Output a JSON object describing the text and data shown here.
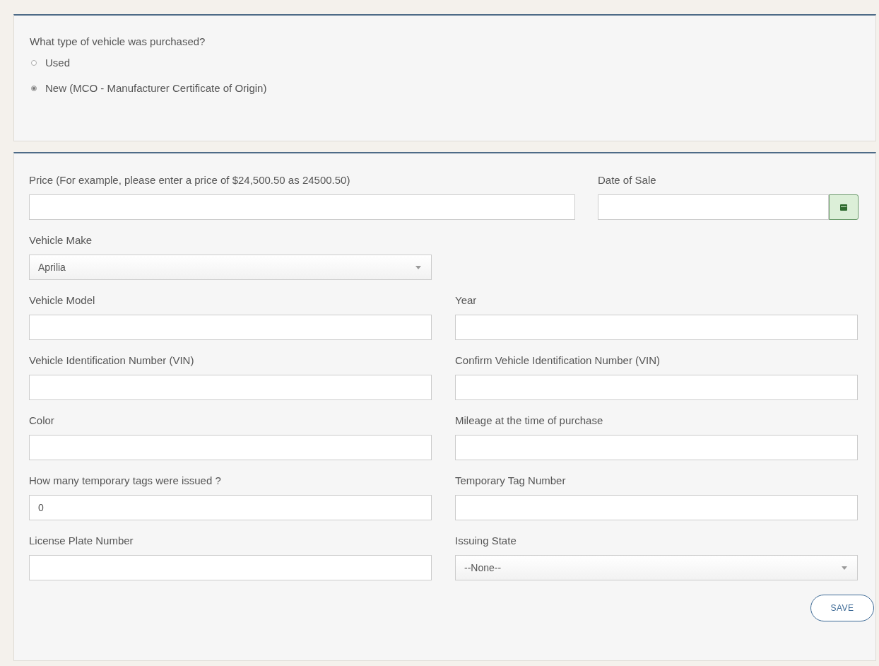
{
  "vehicle_type": {
    "question": "What type of vehicle was purchased?",
    "options": [
      {
        "label": "Used",
        "selected": false
      },
      {
        "label": "New (MCO - Manufacturer Certificate of Origin)",
        "selected": true
      }
    ]
  },
  "form": {
    "rows": [
      {
        "fields": [
          {
            "kind": "text",
            "label": "Price (For example, please enter a price of $24,500.50 as 24500.50)"
          },
          {
            "kind": "date",
            "label": "Date of Sale"
          }
        ]
      },
      {
        "fields": [
          {
            "kind": "select",
            "label": "Vehicle Make",
            "value": "Aprilia"
          }
        ]
      },
      {
        "fields": [
          {
            "kind": "text",
            "label": "Vehicle Model"
          },
          {
            "kind": "text",
            "label": "Year"
          }
        ]
      },
      {
        "fields": [
          {
            "kind": "text",
            "label": "Vehicle Identification Number (VIN)"
          },
          {
            "kind": "text",
            "label": "Confirm Vehicle Identification Number (VIN)"
          }
        ]
      },
      {
        "fields": [
          {
            "kind": "text",
            "label": "Color"
          },
          {
            "kind": "text",
            "label": "Mileage at the time of purchase"
          }
        ]
      },
      {
        "fields": [
          {
            "kind": "text",
            "label": "How many temporary tags were issued ?",
            "value": "0"
          },
          {
            "kind": "text",
            "label": "Temporary Tag Number"
          }
        ]
      },
      {
        "fields": [
          {
            "kind": "text",
            "label": "License Plate Number"
          },
          {
            "kind": "select",
            "label": "Issuing State",
            "value": "--None--"
          }
        ]
      }
    ],
    "save_button": "SAVE"
  }
}
